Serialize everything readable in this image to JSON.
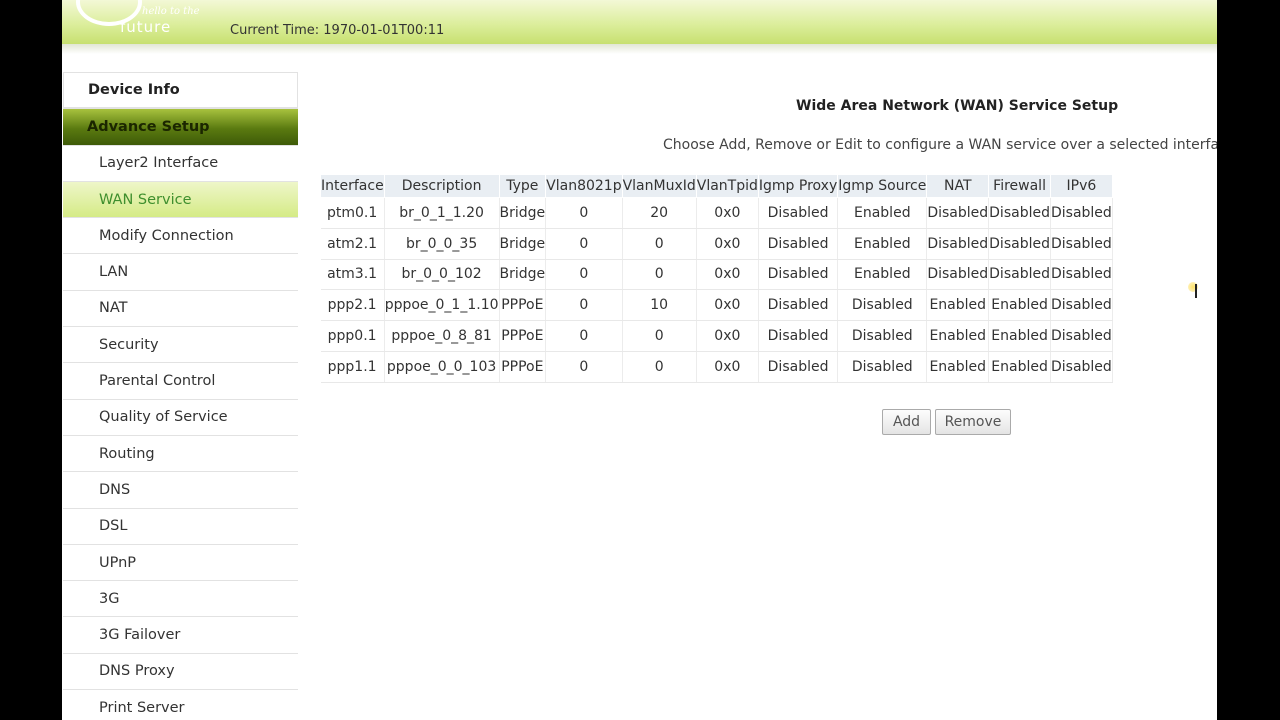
{
  "header": {
    "logo_tagline": "hello to the",
    "logo_word": "future",
    "current_time": "Current Time: 1970-01-01T00:11"
  },
  "sidebar": {
    "items": [
      {
        "label": "Device Info",
        "level": "top"
      },
      {
        "label": "Advance Setup",
        "level": "active-top"
      },
      {
        "label": "Layer2 Interface",
        "level": "sub"
      },
      {
        "label": "WAN Service",
        "level": "active-sub"
      },
      {
        "label": "Modify Connection",
        "level": "sub"
      },
      {
        "label": "LAN",
        "level": "sub"
      },
      {
        "label": "NAT",
        "level": "sub"
      },
      {
        "label": "Security",
        "level": "sub"
      },
      {
        "label": "Parental Control",
        "level": "sub"
      },
      {
        "label": "Quality of Service",
        "level": "sub"
      },
      {
        "label": "Routing",
        "level": "sub"
      },
      {
        "label": "DNS",
        "level": "sub"
      },
      {
        "label": "DSL",
        "level": "sub"
      },
      {
        "label": "UPnP",
        "level": "sub"
      },
      {
        "label": "3G",
        "level": "sub"
      },
      {
        "label": "3G Failover",
        "level": "sub"
      },
      {
        "label": "DNS Proxy",
        "level": "sub"
      },
      {
        "label": "Print Server",
        "level": "sub"
      }
    ]
  },
  "main": {
    "title": "Wide Area Network (WAN) Service Setup",
    "description": "Choose Add, Remove or Edit to configure a WAN service over a selected interface.",
    "table": {
      "columns": [
        "Interface",
        "Description",
        "Type",
        "Vlan8021p",
        "VlanMuxId",
        "VlanTpid",
        "Igmp Proxy",
        "Igmp Source",
        "NAT",
        "Firewall",
        "IPv6"
      ],
      "rows": [
        [
          "ptm0.1",
          "br_0_1_1.20",
          "Bridge",
          "0",
          "20",
          "0x0",
          "Disabled",
          "Enabled",
          "Disabled",
          "Disabled",
          "Disabled"
        ],
        [
          "atm2.1",
          "br_0_0_35",
          "Bridge",
          "0",
          "0",
          "0x0",
          "Disabled",
          "Enabled",
          "Disabled",
          "Disabled",
          "Disabled"
        ],
        [
          "atm3.1",
          "br_0_0_102",
          "Bridge",
          "0",
          "0",
          "0x0",
          "Disabled",
          "Enabled",
          "Disabled",
          "Disabled",
          "Disabled"
        ],
        [
          "ppp2.1",
          "pppoe_0_1_1.10",
          "PPPoE",
          "0",
          "10",
          "0x0",
          "Disabled",
          "Disabled",
          "Enabled",
          "Enabled",
          "Disabled"
        ],
        [
          "ppp0.1",
          "pppoe_0_8_81",
          "PPPoE",
          "0",
          "0",
          "0x0",
          "Disabled",
          "Disabled",
          "Enabled",
          "Enabled",
          "Disabled"
        ],
        [
          "ppp1.1",
          "pppoe_0_0_103",
          "PPPoE",
          "0",
          "0",
          "0x0",
          "Disabled",
          "Disabled",
          "Enabled",
          "Enabled",
          "Disabled"
        ]
      ]
    },
    "buttons": {
      "add_label": "Add",
      "remove_label": "Remove"
    }
  },
  "colors": {
    "header_green": "#c7e070",
    "active_menu": "#5a7a10",
    "active_sub_text": "#3f8f2e",
    "table_header_bg": "#e9eef3"
  }
}
